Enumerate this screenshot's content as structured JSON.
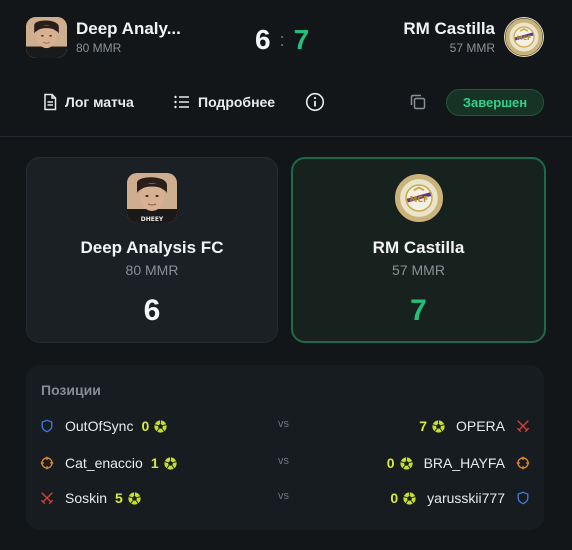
{
  "header": {
    "team_a": {
      "name": "Deep Analy...",
      "mmr": "80 MMR",
      "avatar_icon": "avatar-photo"
    },
    "team_b": {
      "name": "RM Castilla",
      "mmr": "57 MMR",
      "avatar_icon": "real-madrid-crest"
    },
    "score_a": "6",
    "separator": ":",
    "score_b": "7"
  },
  "toolbar": {
    "log_label": "Лог матча",
    "details_label": "Подробнее",
    "status": "Завершен"
  },
  "cards": {
    "left": {
      "name": "Deep Analysis FC",
      "mmr": "80 MMR",
      "score": "6",
      "avatar_text": "DHEEY"
    },
    "right": {
      "name": "RM Castilla",
      "mmr": "57 MMR",
      "score": "7"
    }
  },
  "positions": {
    "title": "Позиции",
    "vs_label": "vs",
    "rows": [
      {
        "left": {
          "player": "OutOfSync",
          "goals": "0",
          "role": "shield-icon"
        },
        "right": {
          "player": "OPERA",
          "goals": "7",
          "role": "swords-icon"
        }
      },
      {
        "left": {
          "player": "Cat_enaccio",
          "goals": "1",
          "role": "crosshair-icon"
        },
        "right": {
          "player": "BRA_HAYFA",
          "goals": "0",
          "role": "crosshair-icon"
        }
      },
      {
        "left": {
          "player": "Soskin",
          "goals": "5",
          "role": "swords-icon"
        },
        "right": {
          "player": "yarusskii777",
          "goals": "0",
          "role": "shield-icon"
        }
      }
    ]
  },
  "colors": {
    "background": "#121619",
    "accent_green": "#22c07a",
    "goal_yellow": "#d7ea3a",
    "shield_blue": "#3b7de0",
    "crosshair_orange": "#e08a2a",
    "swords_red": "#d9403a"
  }
}
